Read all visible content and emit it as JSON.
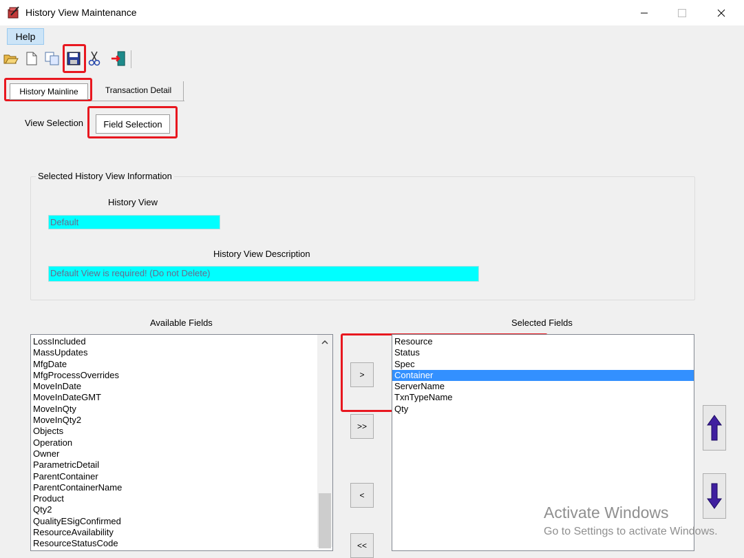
{
  "window": {
    "title": "History View Maintenance"
  },
  "menu": {
    "help": "Help"
  },
  "toolbar": {
    "icons": [
      "open-folder-icon",
      "new-document-icon",
      "copy-icon",
      "save-icon",
      "cut-icon",
      "exit-icon"
    ]
  },
  "tabs": {
    "main": [
      {
        "label": "History Mainline"
      },
      {
        "label": "Transaction Detail"
      }
    ],
    "sub": [
      {
        "label": "View Selection"
      },
      {
        "label": "Field Selection"
      }
    ]
  },
  "info": {
    "legend": "Selected History View Information",
    "history_view_label": "History View",
    "history_view_value": "Default",
    "description_label": "History View Description",
    "description_value": "Default View is required!  (Do not Delete)"
  },
  "available": {
    "label": "Available Fields",
    "items": [
      "LossIncluded",
      "MassUpdates",
      "MfgDate",
      "MfgProcessOverrides",
      "MoveInDate",
      "MoveInDateGMT",
      "MoveInQty",
      "MoveInQty2",
      "Objects",
      "Operation",
      "Owner",
      "ParametricDetail",
      "ParentContainer",
      "ParentContainerName",
      "Product",
      "Qty2",
      "QualityESigConfirmed",
      "ResourceAvailability",
      "ResourceStatusCode"
    ]
  },
  "selected": {
    "label": "Selected Fields",
    "items": [
      "Resource",
      "Status",
      "Spec",
      "Container",
      "ServerName",
      "TxnTypeName",
      "Qty"
    ],
    "selected_item": "Container"
  },
  "move_buttons": {
    "add": ">",
    "add_all": ">>",
    "remove": "<",
    "remove_all": "<<"
  },
  "watermark": {
    "title": "Activate Windows",
    "subtitle": "Go to Settings to activate Windows."
  },
  "colors": {
    "highlight": "#e8171f",
    "field_bg": "#00ffff",
    "selection": "#3390ff",
    "arrow": "#3f1f9f"
  }
}
